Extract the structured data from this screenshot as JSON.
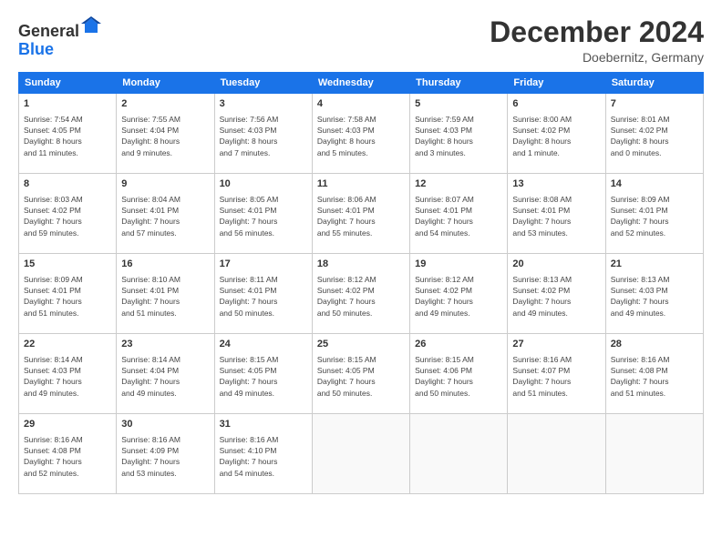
{
  "header": {
    "logo_general": "General",
    "logo_blue": "Blue",
    "month_title": "December 2024",
    "location": "Doebernitz, Germany"
  },
  "weekdays": [
    "Sunday",
    "Monday",
    "Tuesday",
    "Wednesday",
    "Thursday",
    "Friday",
    "Saturday"
  ],
  "weeks": [
    [
      {
        "day": "1",
        "info": "Sunrise: 7:54 AM\nSunset: 4:05 PM\nDaylight: 8 hours\nand 11 minutes."
      },
      {
        "day": "2",
        "info": "Sunrise: 7:55 AM\nSunset: 4:04 PM\nDaylight: 8 hours\nand 9 minutes."
      },
      {
        "day": "3",
        "info": "Sunrise: 7:56 AM\nSunset: 4:03 PM\nDaylight: 8 hours\nand 7 minutes."
      },
      {
        "day": "4",
        "info": "Sunrise: 7:58 AM\nSunset: 4:03 PM\nDaylight: 8 hours\nand 5 minutes."
      },
      {
        "day": "5",
        "info": "Sunrise: 7:59 AM\nSunset: 4:03 PM\nDaylight: 8 hours\nand 3 minutes."
      },
      {
        "day": "6",
        "info": "Sunrise: 8:00 AM\nSunset: 4:02 PM\nDaylight: 8 hours\nand 1 minute."
      },
      {
        "day": "7",
        "info": "Sunrise: 8:01 AM\nSunset: 4:02 PM\nDaylight: 8 hours\nand 0 minutes."
      }
    ],
    [
      {
        "day": "8",
        "info": "Sunrise: 8:03 AM\nSunset: 4:02 PM\nDaylight: 7 hours\nand 59 minutes."
      },
      {
        "day": "9",
        "info": "Sunrise: 8:04 AM\nSunset: 4:01 PM\nDaylight: 7 hours\nand 57 minutes."
      },
      {
        "day": "10",
        "info": "Sunrise: 8:05 AM\nSunset: 4:01 PM\nDaylight: 7 hours\nand 56 minutes."
      },
      {
        "day": "11",
        "info": "Sunrise: 8:06 AM\nSunset: 4:01 PM\nDaylight: 7 hours\nand 55 minutes."
      },
      {
        "day": "12",
        "info": "Sunrise: 8:07 AM\nSunset: 4:01 PM\nDaylight: 7 hours\nand 54 minutes."
      },
      {
        "day": "13",
        "info": "Sunrise: 8:08 AM\nSunset: 4:01 PM\nDaylight: 7 hours\nand 53 minutes."
      },
      {
        "day": "14",
        "info": "Sunrise: 8:09 AM\nSunset: 4:01 PM\nDaylight: 7 hours\nand 52 minutes."
      }
    ],
    [
      {
        "day": "15",
        "info": "Sunrise: 8:09 AM\nSunset: 4:01 PM\nDaylight: 7 hours\nand 51 minutes."
      },
      {
        "day": "16",
        "info": "Sunrise: 8:10 AM\nSunset: 4:01 PM\nDaylight: 7 hours\nand 51 minutes."
      },
      {
        "day": "17",
        "info": "Sunrise: 8:11 AM\nSunset: 4:01 PM\nDaylight: 7 hours\nand 50 minutes."
      },
      {
        "day": "18",
        "info": "Sunrise: 8:12 AM\nSunset: 4:02 PM\nDaylight: 7 hours\nand 50 minutes."
      },
      {
        "day": "19",
        "info": "Sunrise: 8:12 AM\nSunset: 4:02 PM\nDaylight: 7 hours\nand 49 minutes."
      },
      {
        "day": "20",
        "info": "Sunrise: 8:13 AM\nSunset: 4:02 PM\nDaylight: 7 hours\nand 49 minutes."
      },
      {
        "day": "21",
        "info": "Sunrise: 8:13 AM\nSunset: 4:03 PM\nDaylight: 7 hours\nand 49 minutes."
      }
    ],
    [
      {
        "day": "22",
        "info": "Sunrise: 8:14 AM\nSunset: 4:03 PM\nDaylight: 7 hours\nand 49 minutes."
      },
      {
        "day": "23",
        "info": "Sunrise: 8:14 AM\nSunset: 4:04 PM\nDaylight: 7 hours\nand 49 minutes."
      },
      {
        "day": "24",
        "info": "Sunrise: 8:15 AM\nSunset: 4:05 PM\nDaylight: 7 hours\nand 49 minutes."
      },
      {
        "day": "25",
        "info": "Sunrise: 8:15 AM\nSunset: 4:05 PM\nDaylight: 7 hours\nand 50 minutes."
      },
      {
        "day": "26",
        "info": "Sunrise: 8:15 AM\nSunset: 4:06 PM\nDaylight: 7 hours\nand 50 minutes."
      },
      {
        "day": "27",
        "info": "Sunrise: 8:16 AM\nSunset: 4:07 PM\nDaylight: 7 hours\nand 51 minutes."
      },
      {
        "day": "28",
        "info": "Sunrise: 8:16 AM\nSunset: 4:08 PM\nDaylight: 7 hours\nand 51 minutes."
      }
    ],
    [
      {
        "day": "29",
        "info": "Sunrise: 8:16 AM\nSunset: 4:08 PM\nDaylight: 7 hours\nand 52 minutes."
      },
      {
        "day": "30",
        "info": "Sunrise: 8:16 AM\nSunset: 4:09 PM\nDaylight: 7 hours\nand 53 minutes."
      },
      {
        "day": "31",
        "info": "Sunrise: 8:16 AM\nSunset: 4:10 PM\nDaylight: 7 hours\nand 54 minutes."
      },
      {
        "day": "",
        "info": ""
      },
      {
        "day": "",
        "info": ""
      },
      {
        "day": "",
        "info": ""
      },
      {
        "day": "",
        "info": ""
      }
    ]
  ]
}
